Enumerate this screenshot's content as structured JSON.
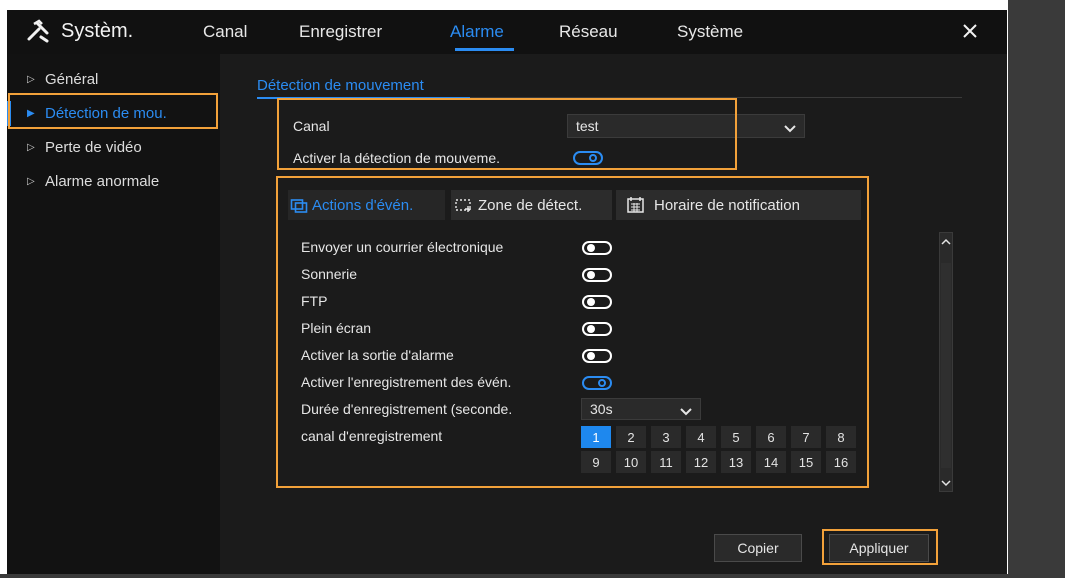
{
  "header": {
    "brand": "Systèm.",
    "tabs": [
      {
        "label": "Canal"
      },
      {
        "label": "Enregistrer"
      },
      {
        "label": "Alarme"
      },
      {
        "label": "Réseau"
      },
      {
        "label": "Système"
      }
    ],
    "active_tab": "Alarme"
  },
  "sidebar": {
    "items": [
      {
        "label": "Général"
      },
      {
        "label": "Détection de mou."
      },
      {
        "label": "Perte de vidéo"
      },
      {
        "label": "Alarme anormale"
      }
    ],
    "active_item": "Détection de mou."
  },
  "main": {
    "subtab": "Détection de mouvement",
    "channel_label": "Canal",
    "channel_value": "test",
    "enable_label": "Activer la détection de mouveme.",
    "enable_on": true,
    "tabs": [
      {
        "label": "Actions d'évén."
      },
      {
        "label": "Zone de détect."
      },
      {
        "label": "Horaire de notification"
      }
    ],
    "actions": [
      {
        "label": "Envoyer un courrier électronique",
        "on": false
      },
      {
        "label": "Sonnerie",
        "on": false
      },
      {
        "label": "FTP",
        "on": false
      },
      {
        "label": "Plein écran",
        "on": false
      },
      {
        "label": "Activer la sortie d'alarme",
        "on": false
      },
      {
        "label": "Activer l'enregistrement des évén.",
        "on": true
      }
    ],
    "duration_label": "Durée d'enregistrement (seconde.",
    "duration_value": "30s",
    "record_channel_label": "canal d'enregistrement",
    "channels": [
      "1",
      "2",
      "3",
      "4",
      "5",
      "6",
      "7",
      "8",
      "9",
      "10",
      "11",
      "12",
      "13",
      "14",
      "15",
      "16"
    ],
    "selected_channel": "1"
  },
  "footer": {
    "copy_label": "Copier",
    "apply_label": "Appliquer"
  },
  "colors": {
    "accent": "#2b8cf2",
    "highlight": "#f2a13a",
    "background": "#1b1b1b"
  }
}
